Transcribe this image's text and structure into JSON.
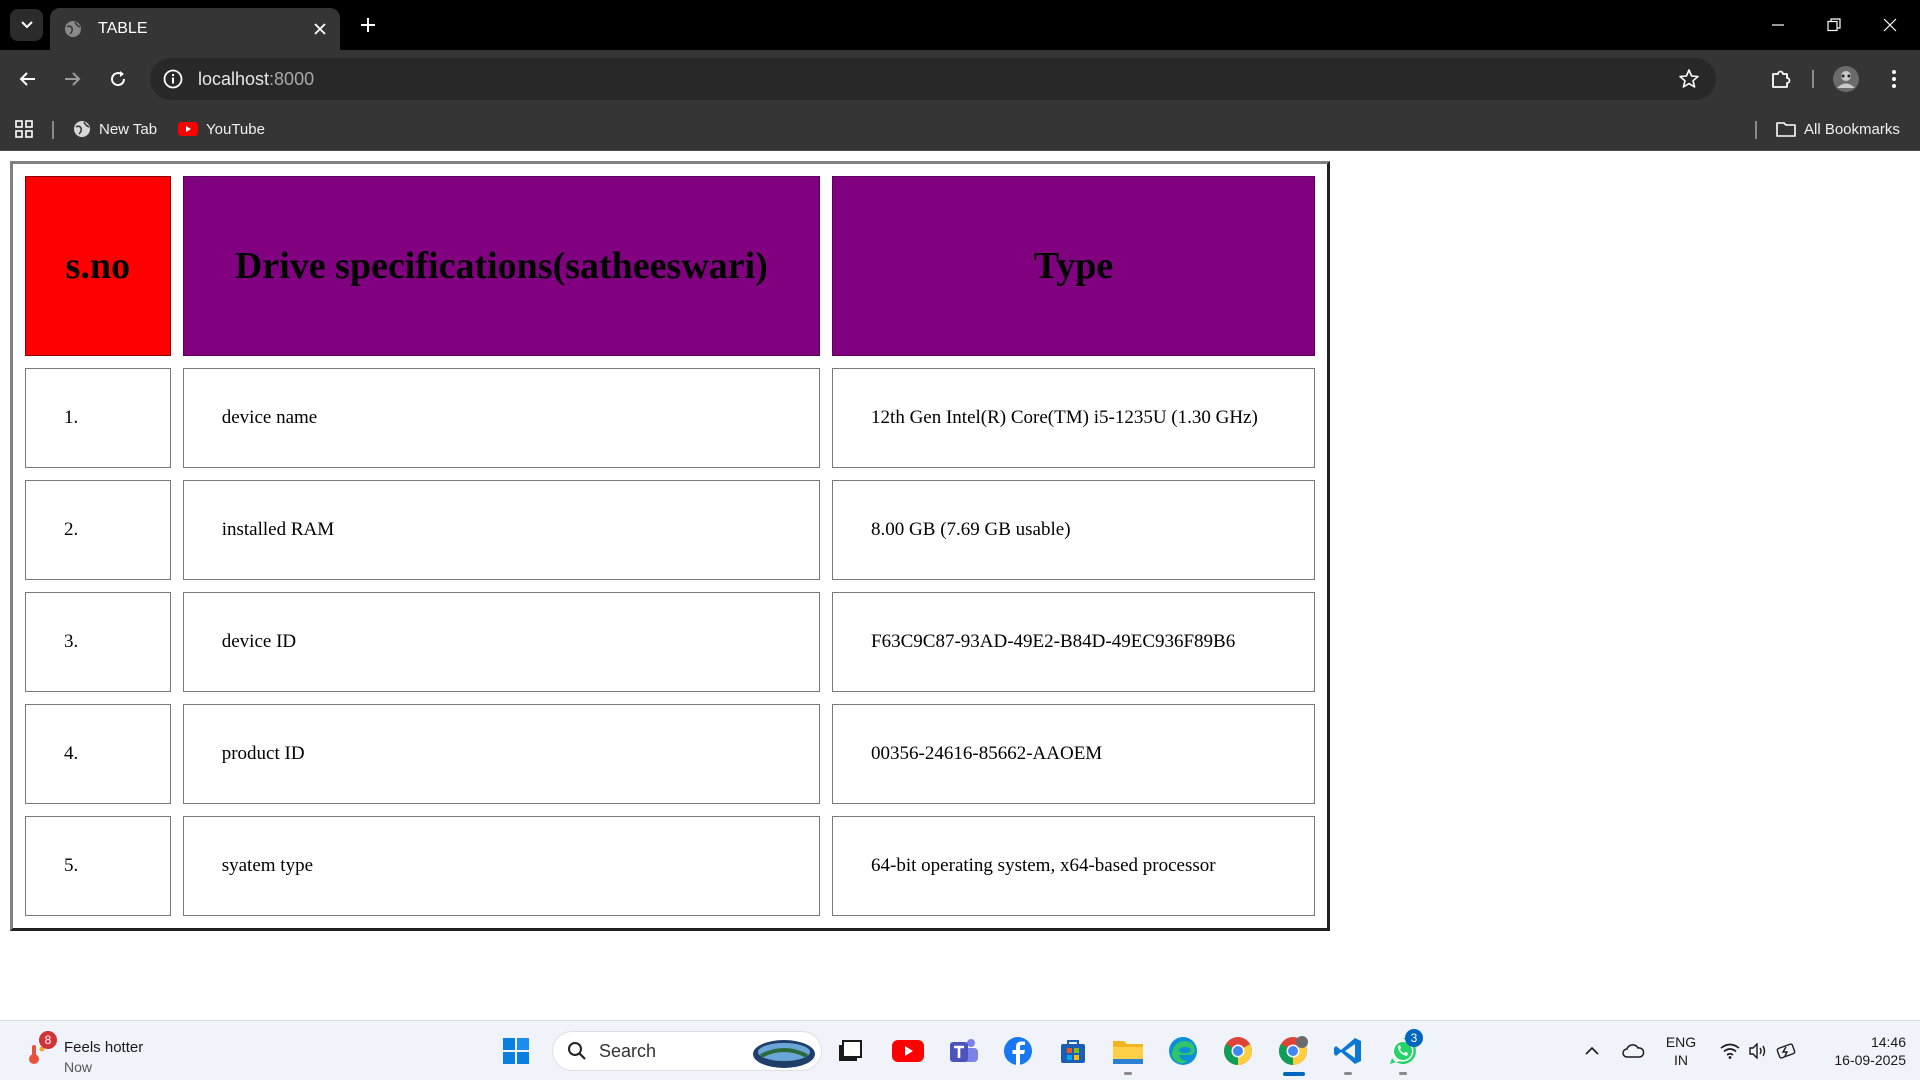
{
  "browser": {
    "tab_title": "TABLE",
    "url_host": "localhost",
    "url_port": ":8000",
    "bookmarks": [
      {
        "label": "New Tab",
        "icon": "globe-icon"
      },
      {
        "label": "YouTube",
        "icon": "youtube-icon"
      }
    ],
    "all_bookmarks_label": "All Bookmarks"
  },
  "table": {
    "headers": [
      "s.no",
      "Drive specifications(satheeswari)",
      "Type"
    ],
    "header_colors": [
      "#ff0000",
      "#800080",
      "#800080"
    ],
    "rows": [
      [
        "1.",
        "device name",
        "12th Gen Intel(R) Core(TM) i5-1235U (1.30 GHz)"
      ],
      [
        "2.",
        "installed RAM",
        "8.00 GB (7.69 GB usable)"
      ],
      [
        "3.",
        "device ID",
        "F63C9C87-93AD-49E2-B84D-49EC936F89B6"
      ],
      [
        "4.",
        "product ID",
        "00356-24616-85662-AAOEM"
      ],
      [
        "5.",
        "syatem type",
        "64-bit operating system, x64-based processor"
      ]
    ]
  },
  "taskbar": {
    "weather_badge": "8",
    "weather_label": "Feels hotter",
    "weather_sub": "Now",
    "search_placeholder": "Search",
    "whatsapp_badge": "3",
    "lang_line1": "ENG",
    "lang_line2": "IN",
    "time": "14:46",
    "date": "16-09-2025"
  }
}
